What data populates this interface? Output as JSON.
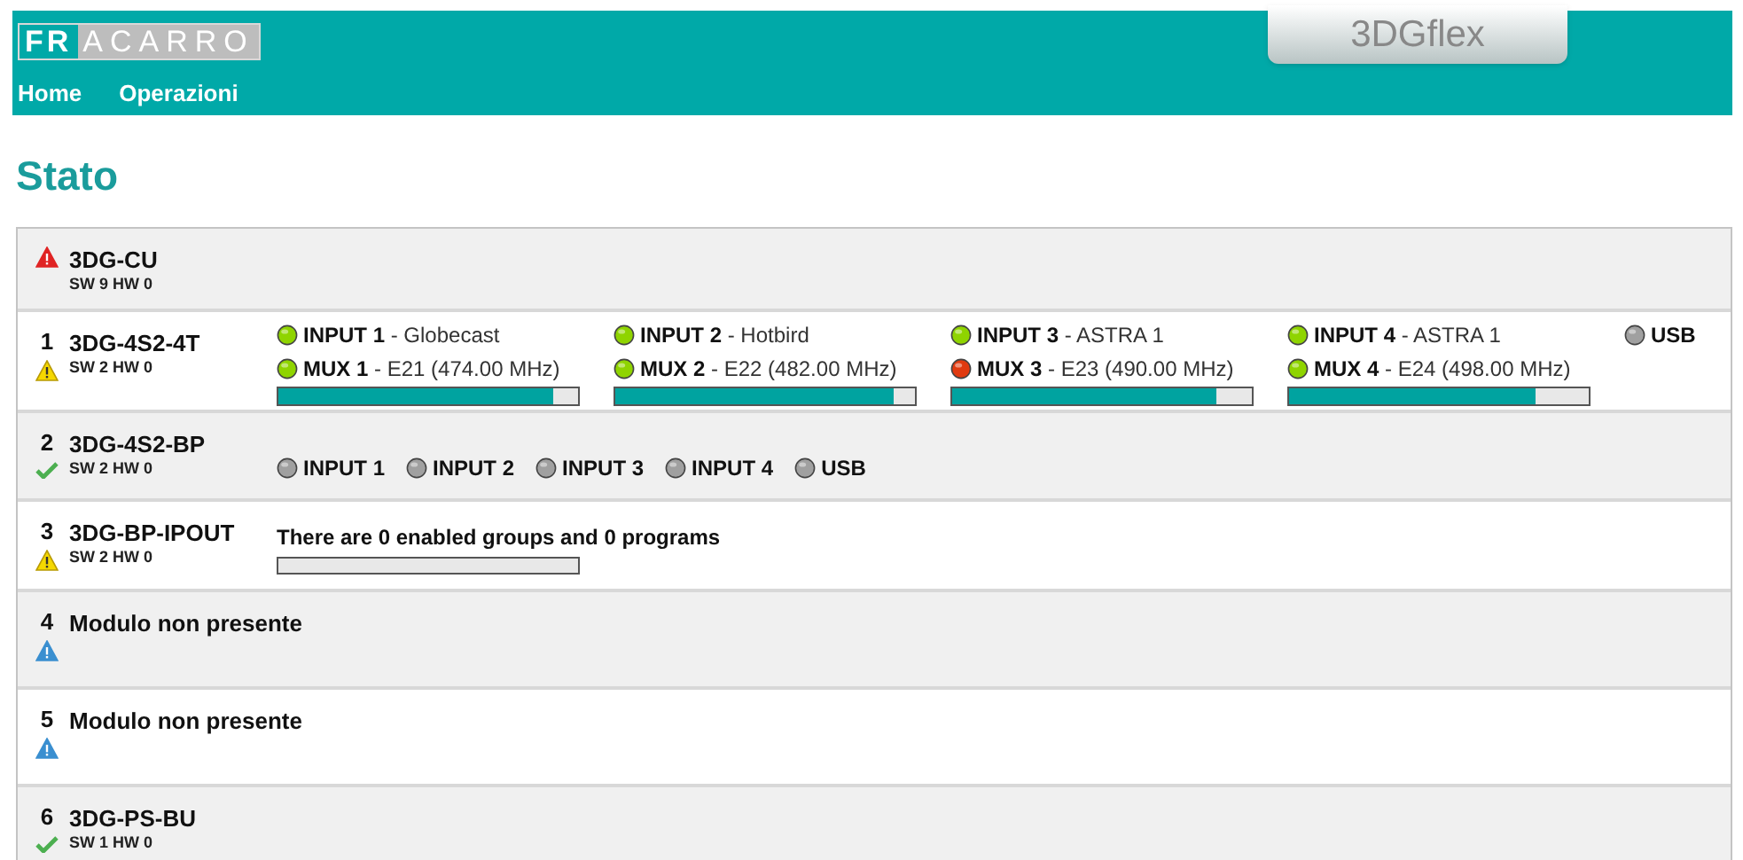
{
  "header": {
    "logo": {
      "mark": "FR",
      "rest": "ACARRO"
    },
    "product": "3DGflex",
    "nav": [
      {
        "label": "Home"
      },
      {
        "label": "Operazioni"
      }
    ]
  },
  "title": "Stato",
  "modules": [
    {
      "name": "3DG-CU",
      "version": "SW 9 HW 0",
      "kind": "fault",
      "content": {
        "kind": "none"
      }
    },
    {
      "slot": "1",
      "name": "3DG-4S2-4T",
      "version": "SW 2 HW 0",
      "kind": "warning",
      "content": {
        "kind": "signals",
        "channels": [
          {
            "input": {
              "label": "INPUT 1",
              "detail": " - Globecast",
              "color": "#8fd400"
            },
            "mux": {
              "label": "MUX 1",
              "detail": " - E21 (474.00 MHz)",
              "color": "#8fd400"
            },
            "bar": {
              "level": 0.92
            }
          },
          {
            "input": {
              "label": "INPUT 2",
              "detail": " - Hotbird",
              "color": "#8fd400"
            },
            "mux": {
              "label": "MUX 2",
              "detail": " - E22 (482.00 MHz)",
              "color": "#8fd400"
            },
            "bar": {
              "level": 0.93
            }
          },
          {
            "input": {
              "label": "INPUT 3",
              "detail": " - ASTRA 1",
              "color": "#8fd400"
            },
            "mux": {
              "label": "MUX 3",
              "detail": " - E23 (490.00 MHz)",
              "color": "#e03a10"
            },
            "bar": {
              "level": 0.88
            }
          },
          {
            "input": {
              "label": "INPUT 4",
              "detail": " - ASTRA 1",
              "color": "#8fd400"
            },
            "mux": {
              "label": "MUX 4",
              "detail": " - E24 (498.00 MHz)",
              "color": "#8fd400"
            },
            "bar": {
              "level": 0.82
            }
          }
        ],
        "usb": {
          "label": "USB",
          "color": "#a0a0a0"
        }
      }
    },
    {
      "slot": "2",
      "name": "3DG-4S2-BP",
      "version": "SW 2 HW 0",
      "kind": "ok",
      "content": {
        "kind": "ports",
        "ports": [
          {
            "label": "INPUT 1",
            "color": "#a0a0a0"
          },
          {
            "label": "INPUT 2",
            "color": "#a0a0a0"
          },
          {
            "label": "INPUT 3",
            "color": "#a0a0a0"
          },
          {
            "label": "INPUT 4",
            "color": "#a0a0a0"
          },
          {
            "label": "USB",
            "color": "#a0a0a0"
          }
        ]
      }
    },
    {
      "slot": "3",
      "name": "3DG-BP-IPOUT",
      "version": "SW 2 HW 0",
      "kind": "warning",
      "content": {
        "kind": "summary",
        "text": "There are 0 enabled groups and 0 programs",
        "bar": {
          "level": 0
        }
      }
    },
    {
      "slot": "4",
      "name": "Modulo non presente",
      "kind": "absent",
      "content": {
        "kind": "none"
      }
    },
    {
      "slot": "5",
      "name": "Modulo non presente",
      "kind": "absent",
      "content": {
        "kind": "none"
      }
    },
    {
      "slot": "6",
      "name": "3DG-PS-BU",
      "version": "SW 1 HW 0",
      "kind": "ok",
      "content": {
        "kind": "none"
      }
    }
  ]
}
